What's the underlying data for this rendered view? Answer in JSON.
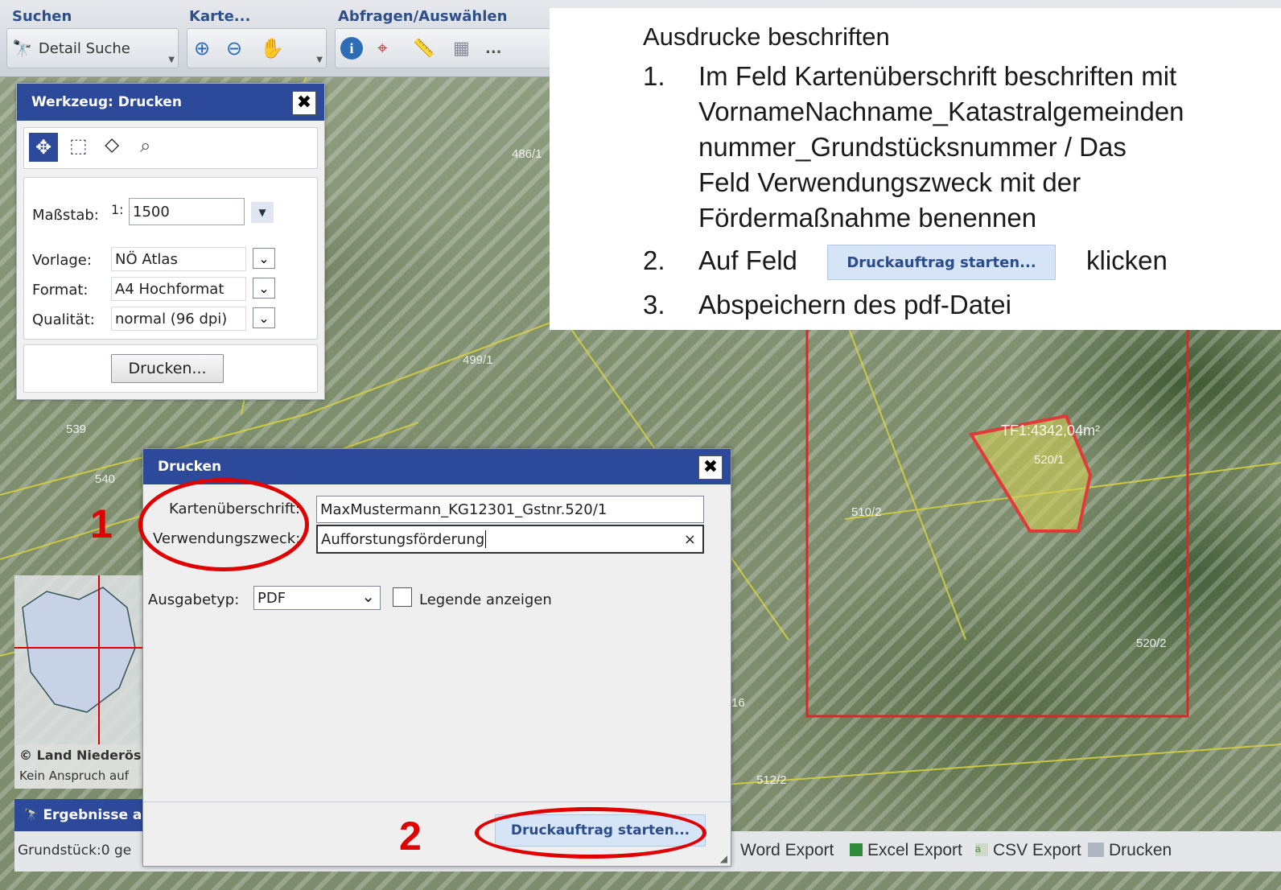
{
  "toolbar": {
    "search_label": "Suchen",
    "map_label": "Karte...",
    "query_label": "Abfragen/Auswählen",
    "detail_search": "Detail Suche",
    "more": "..."
  },
  "map": {
    "parcels": [
      "486/1",
      "499/1",
      "539",
      "540",
      "510/2",
      "520/1",
      "520/2",
      "512/2",
      "16"
    ],
    "area_label": "TF1:4342,04m²",
    "copyright": "© Land Niederös",
    "disclaimer": "Kein Anspruch auf"
  },
  "werkzeug": {
    "title": "Werkzeug: Drucken",
    "scale_label": "Maßstab:",
    "scale_prefix": "1:",
    "scale_value": "1500",
    "template_label": "Vorlage:",
    "template_value": "NÖ Atlas",
    "format_label": "Format:",
    "format_value": "A4 Hochformat",
    "quality_label": "Qualität:",
    "quality_value": "normal (96 dpi)",
    "print_button": "Drucken..."
  },
  "instructions": {
    "title": "Ausdrucke beschriften",
    "step1_num": "1.",
    "step1_lines": [
      "Im Feld Kartenüberschrift beschriften mit",
      "VornameNachname_Katastralgemeinden",
      "nummer_Grundstücksnummer  /  Das",
      "Feld Verwendungszweck mit der",
      "Fördermaßnahme benennen"
    ],
    "step2_num": "2.",
    "step2_pre": "Auf Feld",
    "step2_button": "Druckauftrag starten...",
    "step2_post": "klicken",
    "step3_num": "3.",
    "step3_text": "Abspeichern des pdf-Datei"
  },
  "dialog": {
    "title": "Drucken",
    "map_title_label": "Kartenüberschrift:",
    "map_title_value": "MaxMustermann_KG12301_Gstnr.520/1",
    "purpose_label": "Verwendungszweck:",
    "purpose_value": "Aufforstungsförderung",
    "output_label": "Ausgabetyp:",
    "output_value": "PDF",
    "legend_label": "Legende anzeigen",
    "start_button": "Druckauftrag starten..."
  },
  "annotations": {
    "one": "1",
    "two": "2"
  },
  "results": {
    "title": "Ergebnisse a",
    "parcel_count": "Grundstück:0 ge",
    "word_export": "Word Export",
    "excel_export": "Excel Export",
    "csv_export": "CSV Export",
    "print": "Drucken"
  },
  "colors": {
    "title_bar": "#2d4a9a",
    "annotation": "#e00000",
    "parcel_line": "#d9d23a"
  }
}
